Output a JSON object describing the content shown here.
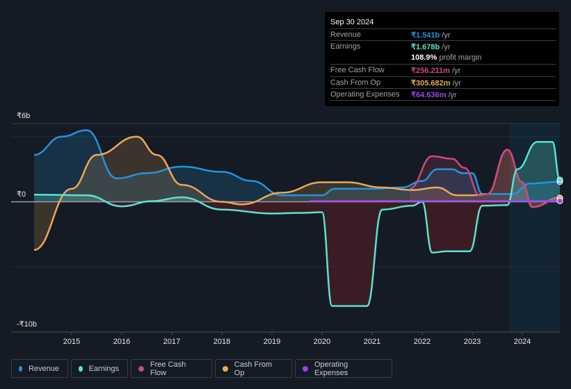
{
  "tooltip": {
    "date": "Sep 30 2024",
    "rows": [
      {
        "label": "Revenue",
        "value": "₹1.541b",
        "unit": " /yr",
        "color": "#2394df"
      },
      {
        "label": "Earnings",
        "value": "₹1.678b",
        "unit": " /yr",
        "color": "#5ce1d0"
      },
      {
        "label": "",
        "value": "108.9%",
        "unit": " profit margin",
        "color": "#ffffff"
      },
      {
        "label": "Free Cash Flow",
        "value": "₹256.211m",
        "unit": " /yr",
        "color": "#c8487f"
      },
      {
        "label": "Cash From Op",
        "value": "₹305.682m",
        "unit": " /yr",
        "color": "#e9a95a"
      },
      {
        "label": "Operating Expenses",
        "value": "₹64.636m",
        "unit": " /yr",
        "color": "#9b45e4"
      }
    ]
  },
  "legend": [
    {
      "label": "Revenue",
      "color": "#2394df"
    },
    {
      "label": "Earnings",
      "color": "#5ce1d0"
    },
    {
      "label": "Free Cash Flow",
      "color": "#c8487f"
    },
    {
      "label": "Cash From Op",
      "color": "#e9a95a"
    },
    {
      "label": "Operating Expenses",
      "color": "#9b45e4"
    }
  ],
  "chart_data": {
    "type": "area",
    "title": "",
    "xlabel": "",
    "ylabel": "",
    "currency": "₹",
    "ylim": [
      -10,
      6
    ],
    "y_unit": "billions",
    "y_ticks": [
      {
        "value": 6,
        "label": "₹6b"
      },
      {
        "value": 0,
        "label": "₹0"
      },
      {
        "value": -10,
        "label": "-₹10b"
      }
    ],
    "x_ticks": [
      "2015",
      "2016",
      "2017",
      "2018",
      "2019",
      "2020",
      "2021",
      "2022",
      "2023",
      "2024"
    ],
    "xlim": [
      2013.55,
      2024.75
    ],
    "highlight_from": 2023.75,
    "grid": true,
    "series": [
      {
        "name": "Revenue",
        "color": "#2394df",
        "x": [
          2014.25,
          2014.8,
          2015.3,
          2015.9,
          2016.5,
          2017.2,
          2018.0,
          2018.6,
          2019.2,
          2020.0,
          2020.25,
          2021.0,
          2021.6,
          2022.0,
          2022.3,
          2022.6,
          2022.8,
          2023.0,
          2023.2,
          2023.8,
          2024.15,
          2024.75
        ],
        "values": [
          3.6,
          5.0,
          5.5,
          1.8,
          2.2,
          2.7,
          2.3,
          1.6,
          0.5,
          0.5,
          1.0,
          1.0,
          1.1,
          1.6,
          2.5,
          2.5,
          2.2,
          2.2,
          0.6,
          0.6,
          1.4,
          1.541
        ]
      },
      {
        "name": "Earnings",
        "color": "#5ce1d0",
        "x": [
          2014.25,
          2015.3,
          2016.0,
          2016.6,
          2017.2,
          2018.0,
          2019.0,
          2019.6,
          2020.0,
          2020.2,
          2020.9,
          2021.2,
          2021.8,
          2022.0,
          2022.2,
          2022.5,
          2022.95,
          2023.2,
          2023.7,
          2023.9,
          2024.3,
          2024.6,
          2024.75
        ],
        "values": [
          0.55,
          0.5,
          -0.35,
          0.05,
          0.35,
          -0.6,
          -0.9,
          -0.85,
          -0.8,
          -8.0,
          -8.0,
          -0.6,
          -0.3,
          0.0,
          -3.9,
          -3.8,
          -3.8,
          -0.3,
          -0.25,
          2.5,
          4.6,
          4.6,
          1.678
        ]
      },
      {
        "name": "Free Cash Flow",
        "color": "#c8487f",
        "x": [
          2021.75,
          2022.2,
          2022.6,
          2022.85,
          2023.15,
          2023.3,
          2023.7,
          2024.0,
          2024.2,
          2024.75
        ],
        "values": [
          1.0,
          3.5,
          3.3,
          2.6,
          0.5,
          0.6,
          4.0,
          1.5,
          -0.4,
          0.256
        ]
      },
      {
        "name": "Cash From Op",
        "color": "#e9a95a",
        "x": [
          2014.25,
          2015.0,
          2015.5,
          2016.3,
          2016.7,
          2017.2,
          2018.0,
          2018.4,
          2019.2,
          2020.0,
          2020.5,
          2021.2,
          2021.8,
          2022.3,
          2022.7,
          2023.0,
          2023.3,
          2023.7,
          2024.0,
          2024.2,
          2024.75
        ],
        "values": [
          -3.7,
          1.0,
          3.6,
          5.0,
          3.6,
          1.3,
          0.0,
          -0.2,
          0.7,
          1.5,
          1.5,
          1.1,
          0.9,
          1.1,
          0.5,
          0.5,
          0.6,
          4.0,
          1.5,
          -0.4,
          0.306
        ]
      },
      {
        "name": "Operating Expenses",
        "color": "#9b45e4",
        "x": [
          2019.75,
          2024.75
        ],
        "values": [
          0.06,
          0.065
        ]
      }
    ]
  }
}
